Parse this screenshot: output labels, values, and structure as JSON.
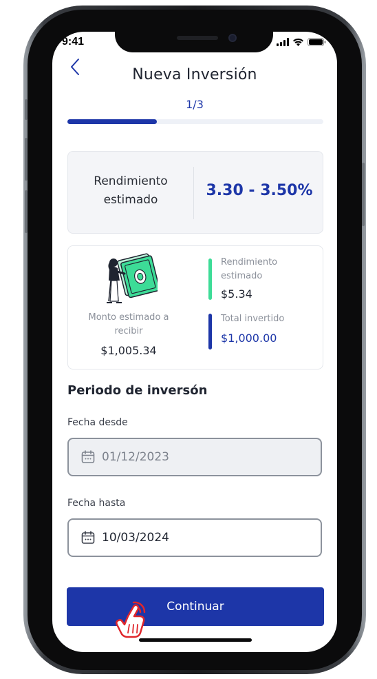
{
  "status_bar": {
    "time": "9:41",
    "icons": [
      "signal-icon",
      "wifi-icon",
      "battery-icon"
    ]
  },
  "header": {
    "back_icon": "chevron-left-icon",
    "title": "Nueva Inversión",
    "step": "1/3",
    "progress": 0.35
  },
  "yield_card": {
    "label": "Rendimiento estimado",
    "value": "3.30 - 3.50%"
  },
  "summary_card": {
    "illustration": "woman-holding-cash-illustration",
    "estimated_amount_label": "Monto estimado a recibir",
    "estimated_amount_value": "$1,005.34",
    "yield_label": "Rendimiento estimado",
    "yield_value": "$5.34",
    "total_label": "Total invertido",
    "total_value": "$1,000.00"
  },
  "period": {
    "title": "Periodo de inversón",
    "from_label": "Fecha desde",
    "from_value": "01/12/2023",
    "to_label": "Fecha hasta",
    "to_value": "10/03/2024",
    "field_icon": "calendar-icon"
  },
  "actions": {
    "continue_label": "Continuar",
    "cursor_icon": "hand-pointer-icon"
  },
  "colors": {
    "primary": "#1d36a8",
    "green": "#3ddc97",
    "pointer_red": "#e0262b"
  }
}
